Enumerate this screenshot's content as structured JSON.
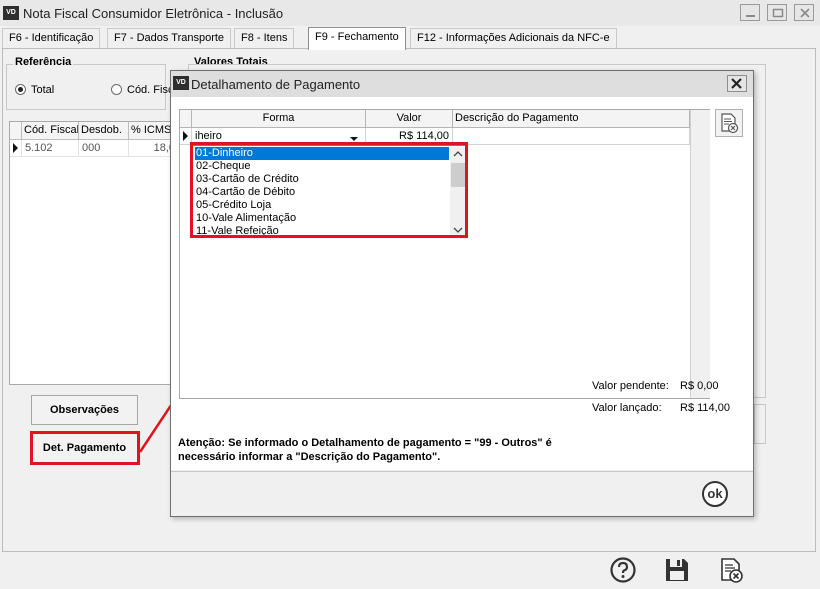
{
  "window": {
    "title": "Nota Fiscal Consumidor Eletrônica - Inclusão",
    "icon_text": "VD"
  },
  "tabs": [
    {
      "label": "F6 - Identificação"
    },
    {
      "label": "F7 - Dados Transporte"
    },
    {
      "label": "F8 - Itens"
    },
    {
      "label": "F9 - Fechamento"
    },
    {
      "label": "F12 - Informações Adicionais da NFC-e"
    }
  ],
  "active_tab": "F9 - Fechamento",
  "referencia": {
    "label": "Referência",
    "options": [
      {
        "label": "Total",
        "selected": true
      },
      {
        "label": "Cód. Fisc"
      }
    ]
  },
  "valores_totais": {
    "label": "Valores Totais"
  },
  "items_grid": {
    "columns": [
      "Cód. Fiscal",
      "Desdob.",
      "% ICMS"
    ],
    "rows": [
      [
        "5.102",
        "000",
        "18,0"
      ]
    ]
  },
  "buttons": {
    "observacoes": "Observações",
    "det_pagamento": "Det. Pagamento"
  },
  "dialog": {
    "title": "Detalhamento de Pagamento",
    "icon_text": "VD",
    "grid": {
      "columns": [
        "Forma",
        "Valor",
        "Descrição do Pagamento"
      ],
      "row": {
        "forma": "iheiro",
        "valor": "R$ 114,00",
        "descricao": ""
      }
    },
    "dropdown_options": [
      "01-Dinheiro",
      "02-Cheque",
      "03-Cartão de Crédito",
      "04-Cartão de Débito",
      "05-Crédito Loja",
      "10-Vale Alimentação",
      "11-Vale Refeição"
    ],
    "selected_option": "01-Dinheiro",
    "pendente_label": "Valor pendente:",
    "pendente_value": "R$ 0,00",
    "lancado_label": "Valor lançado:",
    "lancado_value": "R$ 114,00",
    "note_line1": "Atenção: Se informado o Detalhamento de pagamento = \"99 - Outros\" é",
    "note_line2": "necessário informar a \"Descrição do Pagamento\".",
    "ok_label": "ok"
  },
  "colors": {
    "highlight": "#e0141e",
    "selection": "#0078d7"
  },
  "icons": [
    "help-icon",
    "save-icon",
    "cancel-document-icon",
    "close-icon",
    "minimize-icon",
    "maximize-icon",
    "dropdown-arrow-icon",
    "row-pointer-icon"
  ]
}
